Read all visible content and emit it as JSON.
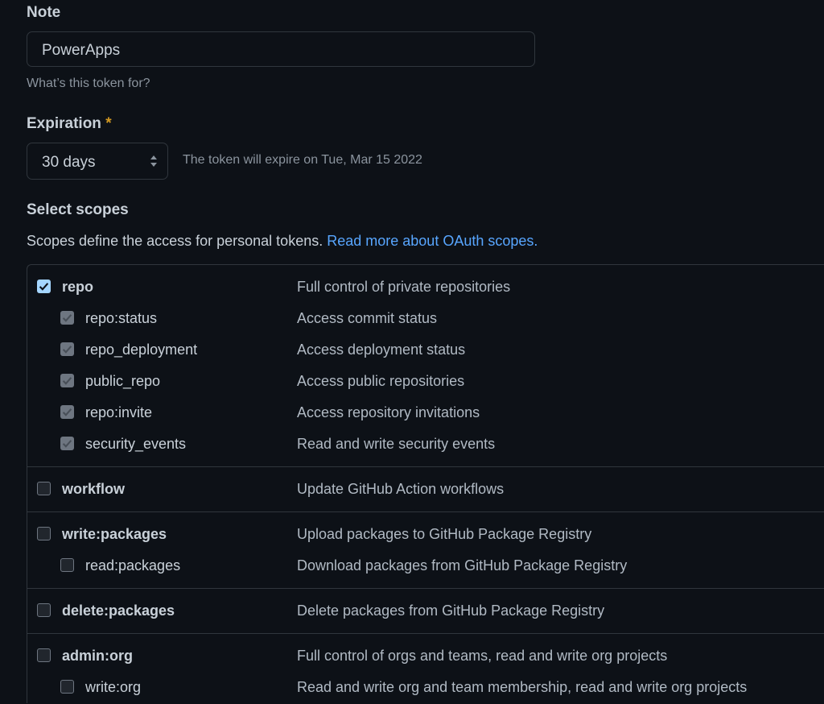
{
  "note": {
    "label": "Note",
    "value": "PowerApps",
    "hint": "What’s this token for?"
  },
  "expiration": {
    "label": "Expiration",
    "required_mark": "*",
    "selected": "30 days",
    "info": "The token will expire on Tue, Mar 15 2022"
  },
  "scopes": {
    "title": "Select scopes",
    "description": "Scopes define the access for personal tokens.",
    "link_text": "Read more about OAuth scopes.",
    "groups": [
      {
        "items": [
          {
            "name": "repo",
            "desc": "Full control of private repositories",
            "checked": true,
            "child": false
          },
          {
            "name": "repo:status",
            "desc": "Access commit status",
            "checked": true,
            "child": true
          },
          {
            "name": "repo_deployment",
            "desc": "Access deployment status",
            "checked": true,
            "child": true
          },
          {
            "name": "public_repo",
            "desc": "Access public repositories",
            "checked": true,
            "child": true
          },
          {
            "name": "repo:invite",
            "desc": "Access repository invitations",
            "checked": true,
            "child": true
          },
          {
            "name": "security_events",
            "desc": "Read and write security events",
            "checked": true,
            "child": true
          }
        ]
      },
      {
        "items": [
          {
            "name": "workflow",
            "desc": "Update GitHub Action workflows",
            "checked": false,
            "child": false
          }
        ]
      },
      {
        "items": [
          {
            "name": "write:packages",
            "desc": "Upload packages to GitHub Package Registry",
            "checked": false,
            "child": false
          },
          {
            "name": "read:packages",
            "desc": "Download packages from GitHub Package Registry",
            "checked": false,
            "child": true
          }
        ]
      },
      {
        "items": [
          {
            "name": "delete:packages",
            "desc": "Delete packages from GitHub Package Registry",
            "checked": false,
            "child": false
          }
        ]
      },
      {
        "items": [
          {
            "name": "admin:org",
            "desc": "Full control of orgs and teams, read and write org projects",
            "checked": false,
            "child": false
          },
          {
            "name": "write:org",
            "desc": "Read and write org and team membership, read and write org projects",
            "checked": false,
            "child": true
          }
        ]
      }
    ]
  },
  "colors": {
    "background": "#0d1117",
    "border": "#30363d",
    "link": "#58a6ff",
    "checkbox_checked": "#a5d6ff",
    "required": "#d29922"
  }
}
